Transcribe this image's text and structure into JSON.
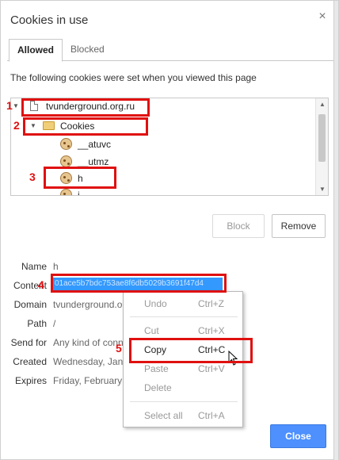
{
  "dialog": {
    "title": "Cookies in use",
    "close_glyph": "×",
    "tabs": [
      {
        "label": "Allowed",
        "active": true
      },
      {
        "label": "Blocked",
        "active": false
      }
    ],
    "description": "The following cookies were set when you viewed this page"
  },
  "tree": {
    "items": [
      {
        "label": "tvunderground.org.ru",
        "icon": "document-icon",
        "level": 0
      },
      {
        "label": "Cookies",
        "icon": "folder-icon",
        "level": 1
      },
      {
        "label": "__atuvc",
        "icon": "cookie-icon",
        "level": 2
      },
      {
        "label": "__utmz",
        "icon": "cookie-icon",
        "level": 2
      },
      {
        "label": "h",
        "icon": "cookie-icon",
        "level": 2
      },
      {
        "label": "i",
        "icon": "cookie-icon",
        "level": 2
      }
    ]
  },
  "buttons": {
    "block": "Block",
    "remove": "Remove",
    "close": "Close"
  },
  "details": {
    "name_label": "Name",
    "name_value": "h",
    "content_label": "Content",
    "content_value": "01ace5b7bdc753ae8f6db5029b3691f47d4",
    "domain_label": "Domain",
    "domain_value": "tvunderground.o",
    "path_label": "Path",
    "path_value": "/",
    "sendfor_label": "Send for",
    "sendfor_value": "Any kind of conn",
    "created_label": "Created",
    "created_value": "Wednesday, Janu",
    "expires_label": "Expires",
    "expires_value": "Friday, February"
  },
  "context_menu": {
    "items": [
      {
        "label": "Undo",
        "shortcut": "Ctrl+Z",
        "enabled": false
      },
      {
        "label": "Cut",
        "shortcut": "Ctrl+X",
        "enabled": false
      },
      {
        "label": "Copy",
        "shortcut": "Ctrl+C",
        "enabled": true
      },
      {
        "label": "Paste",
        "shortcut": "Ctrl+V",
        "enabled": false
      },
      {
        "label": "Delete",
        "shortcut": "",
        "enabled": false
      },
      {
        "label": "Select all",
        "shortcut": "Ctrl+A",
        "enabled": true
      }
    ]
  },
  "annotations": {
    "color": "#e01010",
    "numbers": [
      "1",
      "2",
      "3",
      "4",
      "5"
    ]
  }
}
